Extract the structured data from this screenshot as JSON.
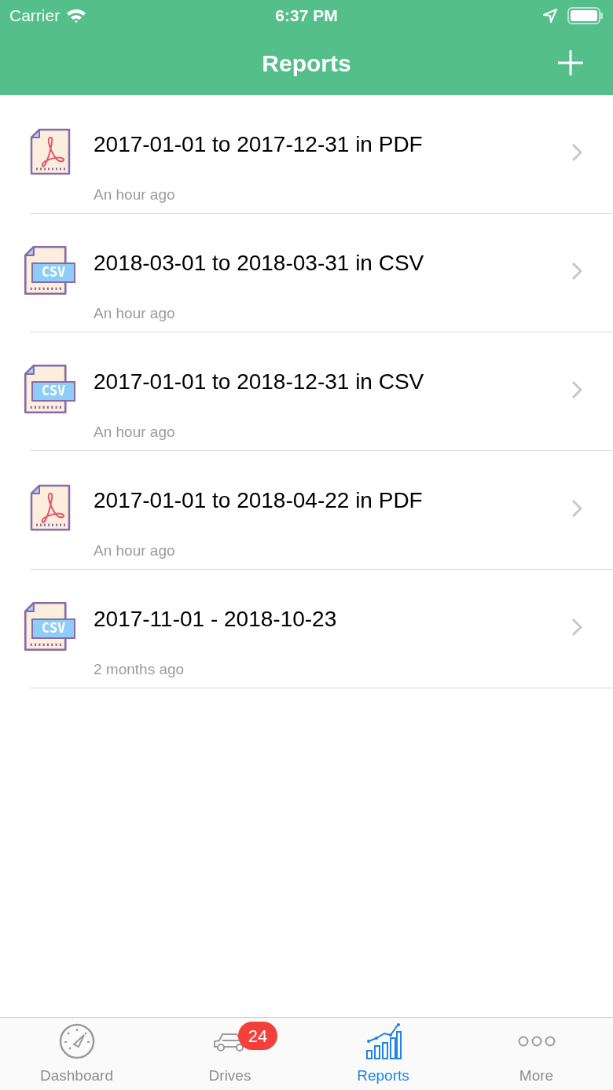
{
  "status_bar": {
    "carrier": "Carrier",
    "time": "6:37 PM"
  },
  "nav": {
    "title": "Reports"
  },
  "reports": [
    {
      "kind": "pdf",
      "title": "2017-01-01 to 2017-12-31 in PDF",
      "subtitle": "An hour ago"
    },
    {
      "kind": "csv",
      "icon_label": "CSV",
      "title": "2018-03-01 to 2018-03-31 in CSV",
      "subtitle": "An hour ago"
    },
    {
      "kind": "csv",
      "icon_label": "CSV",
      "title": "2017-01-01 to 2018-12-31 in CSV",
      "subtitle": "An hour ago"
    },
    {
      "kind": "pdf",
      "title": "2017-01-01 to 2018-04-22 in PDF",
      "subtitle": "An hour ago"
    },
    {
      "kind": "csv",
      "icon_label": "CSV",
      "title": "2017-11-01 - 2018-10-23",
      "subtitle": "2 months ago"
    }
  ],
  "tab_bar": [
    {
      "kind": "dashboard",
      "label": "Dashboard",
      "selected": false
    },
    {
      "kind": "drives",
      "label": "Drives",
      "selected": false,
      "badge": "24"
    },
    {
      "kind": "reports",
      "label": "Reports",
      "selected": true
    },
    {
      "kind": "more",
      "label": "More",
      "selected": false
    }
  ]
}
